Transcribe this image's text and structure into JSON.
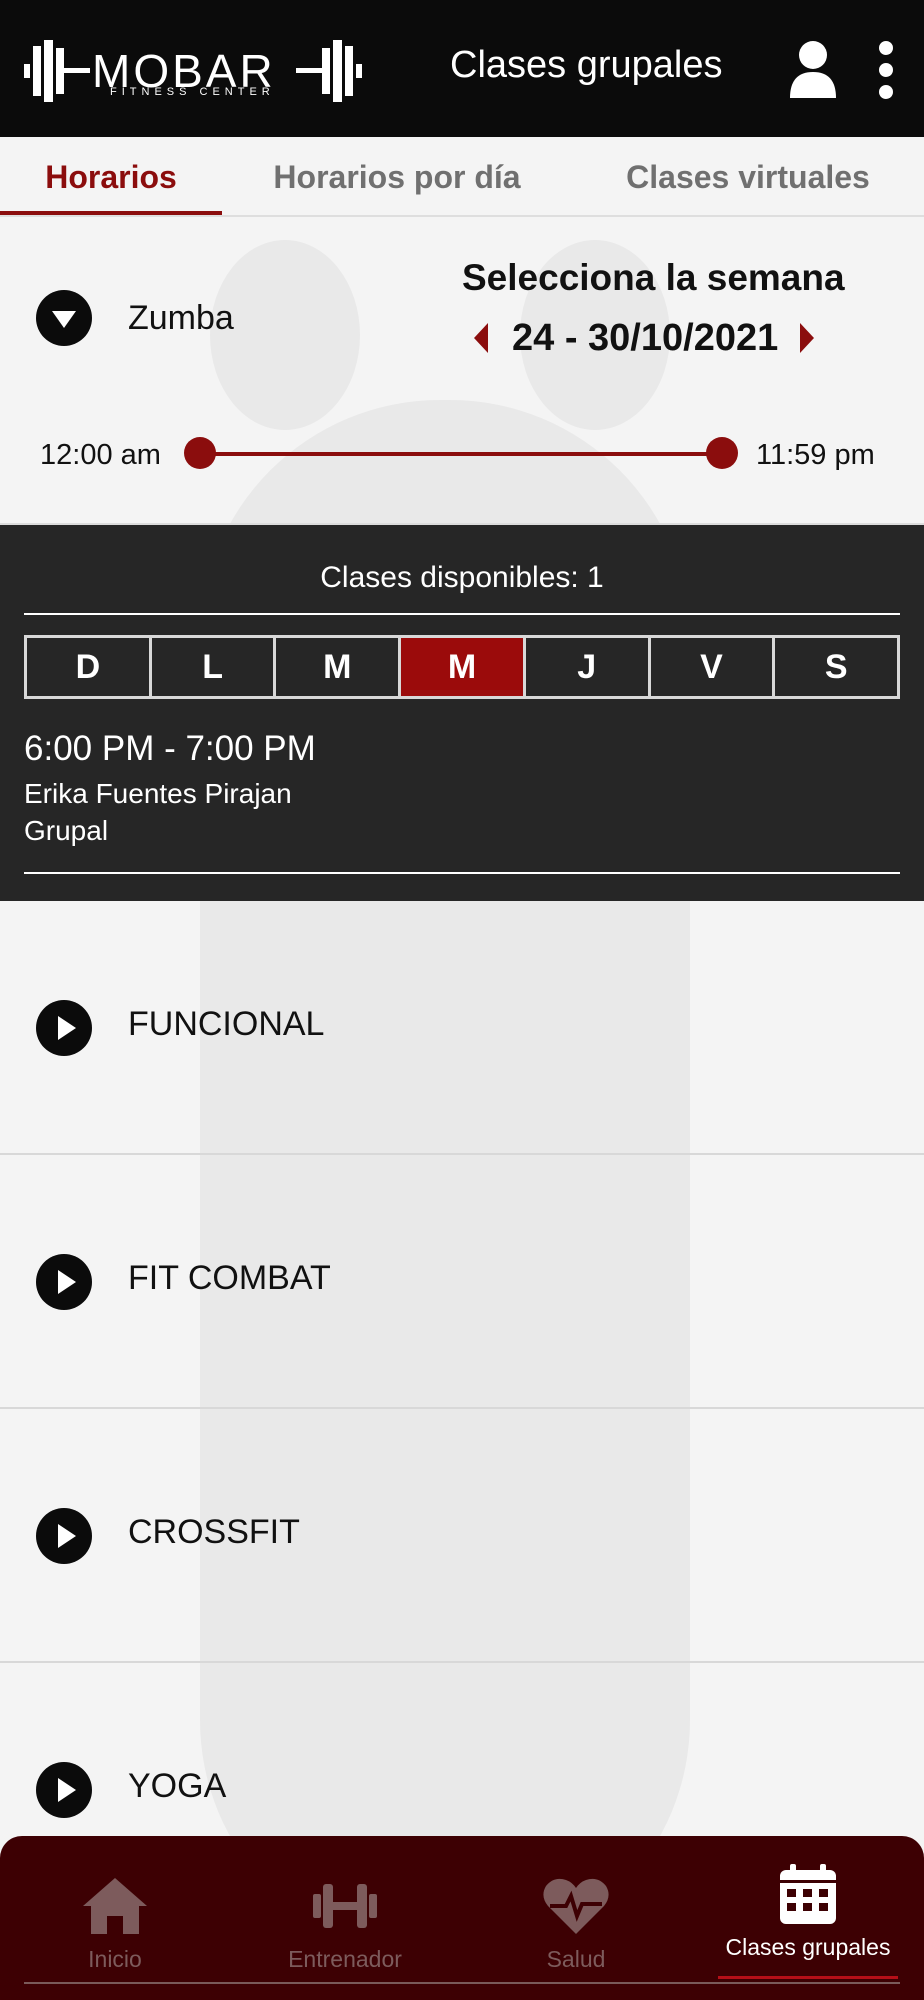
{
  "header": {
    "logo_text": "MOBAR",
    "logo_subtitle": "FITNESS CENTER",
    "title": "Clases grupales",
    "icons": [
      "user-icon",
      "more-vertical-icon"
    ]
  },
  "tabs": [
    {
      "label": "Horarios",
      "active": true
    },
    {
      "label": "Horarios por día",
      "active": false
    },
    {
      "label": "Clases virtuales",
      "active": false
    }
  ],
  "filter": {
    "selected_class": "Zumba",
    "week_label": "Selecciona la semana",
    "week_range": "24 - 30/10/2021",
    "time_start": "12:00 am",
    "time_end": "11:59 pm",
    "accent_color": "#8b0d0d"
  },
  "schedule": {
    "available_text": "Clases disponibles: 1",
    "days": [
      "D",
      "L",
      "M",
      "M",
      "J",
      "V",
      "S"
    ],
    "active_day_index": 3,
    "session": {
      "time": "6:00 PM - 7:00 PM",
      "trainer": "Erika Fuentes Pirajan",
      "type": "Grupal"
    }
  },
  "classes": [
    {
      "name": "FUNCIONAL"
    },
    {
      "name": "FIT COMBAT"
    },
    {
      "name": "CROSSFIT"
    },
    {
      "name": "YOGA"
    }
  ],
  "bottom_nav": [
    {
      "label": "Inicio",
      "icon": "home-icon",
      "active": false
    },
    {
      "label": "Entrenador",
      "icon": "dumbbell-icon",
      "active": false
    },
    {
      "label": "Salud",
      "icon": "heart-pulse-icon",
      "active": false
    },
    {
      "label": "Clases grupales",
      "icon": "calendar-icon",
      "active": true
    }
  ]
}
